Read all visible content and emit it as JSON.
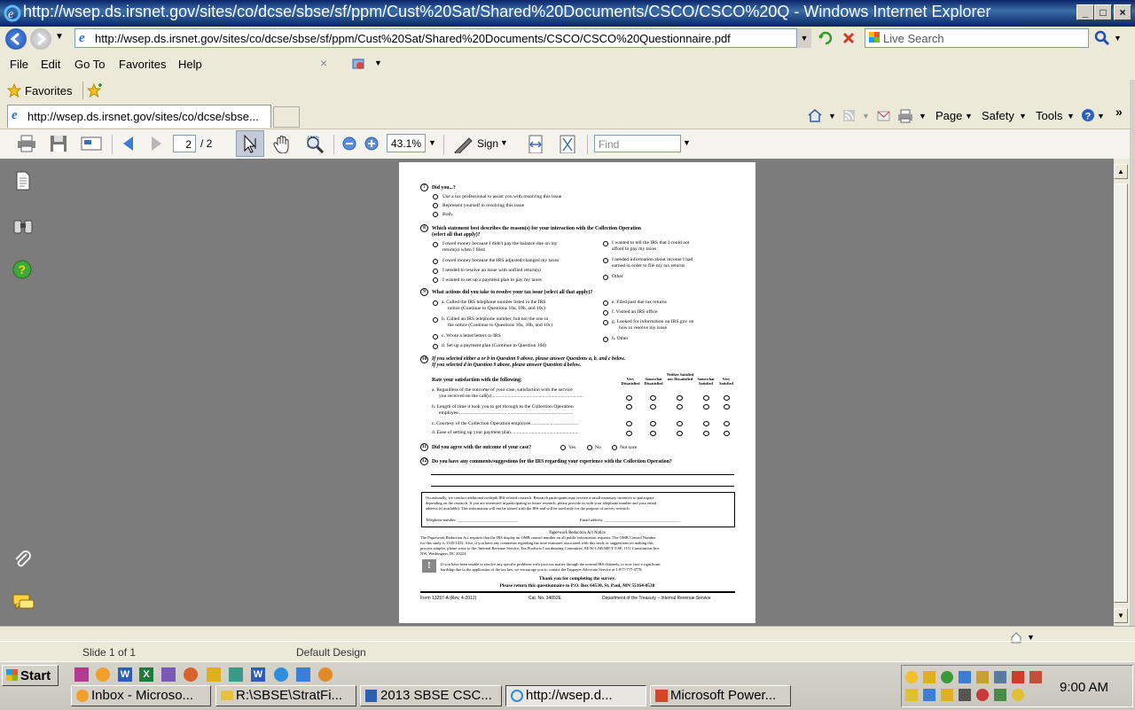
{
  "window": {
    "title": "http://wsep.ds.irsnet.gov/sites/co/dcse/sbse/sf/ppm/Cust%20Sat/Shared%20Documents/CSCO/CSCO%20Q - Windows Internet Explorer"
  },
  "address": {
    "url": "http://wsep.ds.irsnet.gov/sites/co/dcse/sbse/sf/ppm/Cust%20Sat/Shared%20Documents/CSCO/CSCO%20Questionnaire.pdf",
    "search_placeholder": "Live Search"
  },
  "menu": [
    "File",
    "Edit",
    "Go To",
    "Favorites",
    "Help"
  ],
  "favorites": {
    "label": "Favorites"
  },
  "tab": {
    "label": "http://wsep.ds.irsnet.gov/sites/co/dcse/sbse..."
  },
  "commandbar": {
    "page": "Page",
    "safety": "Safety",
    "tools": "Tools"
  },
  "pdf_toolbar": {
    "page_current": "2",
    "page_total": "/ 2",
    "zoom": "43.1%",
    "sign": "Sign",
    "find_placeholder": "Find"
  },
  "document": {
    "q7": {
      "num": "7",
      "text": "Did you...?",
      "options": [
        "Use a tax professional to assist you with resolving this issue",
        "Represent yourself in resolving this issue",
        "Both"
      ]
    },
    "q8": {
      "num": "8",
      "text1": "Which statement best describes the reason(s) for your interaction with the Collection Operation",
      "text2": "(select all that apply)?",
      "left": [
        "I owed money because I didn't pay the balance due on my",
        "return(s) when I filed",
        "I owed money because the IRS adjusted/changed my taxes",
        "I needed to resolve an issue with unfiled return(s)",
        "I wanted to set up a payment plan to pay my taxes"
      ],
      "right": [
        "I wanted to tell the IRS that I could not",
        "afford to pay my taxes",
        "I needed information about income I had",
        "earned in order to file my tax returns",
        "Other"
      ]
    },
    "q9": {
      "num": "9",
      "text": "What actions did you take to resolve your tax issue (select all that apply)?",
      "left": [
        "a. Called the IRS telephone number listed in the IRS",
        "notice (Continue to Questions 10a, 10b, and 10c)",
        "b. Called an IRS telephone number, but not the one in",
        "the notice (Continue to Questions 10a, 10b, and 10c)",
        "c. Wrote a letter/letters to IRS",
        "d. Set up a payment plan (Continue to Question 10d)"
      ],
      "right": [
        "e. Filed past due tax returns",
        "f. Visited an IRS office",
        "g. Looked for information on IRS.gov on",
        "how to resolve my issue",
        "h. Other"
      ]
    },
    "q10": {
      "num": "10",
      "text1": "If you selected either a or b in Question 9 above, please answer Questions a, b, and c below.",
      "text2": "If you selected d in Question 9 above, please answer Question d below.",
      "rate": "Rate your satisfaction with the following:",
      "scale": [
        "Very Dissatisfied",
        "Somewhat Dissatisfied",
        "Neither Satisfied nor Dissatisfied",
        "Somewhat Satisfied",
        "Very Satisfied"
      ],
      "items": [
        "a.  Regardless of the outcome of your case, satisfaction with the service",
        "you received on the call(s)..........................................................................",
        "b.  Length of time it took you to get through to the Collection Operation",
        "employee.............................................................................................",
        "c.  Courtesy of the Collection Operation employee......................................",
        "d.  Ease of setting up your payment plan.......................................................",
        "",
        ""
      ]
    },
    "q11": {
      "num": "11",
      "text": "Did you agree with the outcome of your case?",
      "yes": "Yes",
      "no": "No",
      "notsure": "Not sure"
    },
    "q12": {
      "num": "12",
      "text": "Do you have any comments/suggestions for the IRS regarding your experience with the Collection Operation?"
    },
    "research": {
      "l1": "Occasionally, we conduct additional in-depth IRS-related research. Research participants may receive a small monetary incentive to participate",
      "l2": "depending on the research. If you are interested in participating in future research, please provide us with your telephone number and your email",
      "l3": "address (if available). This information will not be shared with the IRS and will be used only for the purpose of survey research.",
      "tel": "Telephone number: ______________________________",
      "email": "Email address: ______________________________________"
    },
    "paperwork": {
      "title": "Paperwork Reduction Act Notice",
      "l1": "The Paperwork Reduction Act requires that the IRS display an OMB control number on all public information requests. The OMB Control Number",
      "l2": "for this study is 1545-1432. Also, if you have any comments regarding the time estimates associated with this study or suggestions on making this",
      "l3": "process simpler, please write to the: Internal Revenue Service, Tax Products Coordinating Committee, SE:W:CAR:MP:T:T:SP, 1111 Constitution Ave.",
      "l4": "NW, Washington, DC 20224."
    },
    "advocate": {
      "l1": "If you have been unable to resolve any specific problems with your tax matter through the normal IRS channels, or now face a significant",
      "l2": "hardship due to the application of the tax law, we encourage you to contact the Taxpayer Advocate Service at 1-877-777-4778."
    },
    "thanks": {
      "l1": "Thank you for completing the survey.",
      "l2": "Please return this questionnaire to P.O. Box 64530, St. Paul, MN 55164-0530"
    },
    "footer": {
      "form": "Form 13257-A (Rev. 4-2012)",
      "cat": "Cat. No. 34052E",
      "dept": "Department of the Treasury – Internal Revenue Service"
    }
  },
  "statusbar": {
    "slide": "Slide 1 of 1",
    "design": "Default Design"
  },
  "taskbar": {
    "start": "Start",
    "tasks": [
      "Inbox - Microso...",
      "R:\\SBSE\\StratFi...",
      "2013 SBSE CSC...",
      "http://wsep.d...",
      "Microsoft Power..."
    ],
    "clock": "9:00 AM"
  },
  "colors": {
    "titlebar": "#0a246a",
    "viewer_bg": "#7c7c7c",
    "help_green": "#3fa73f"
  }
}
